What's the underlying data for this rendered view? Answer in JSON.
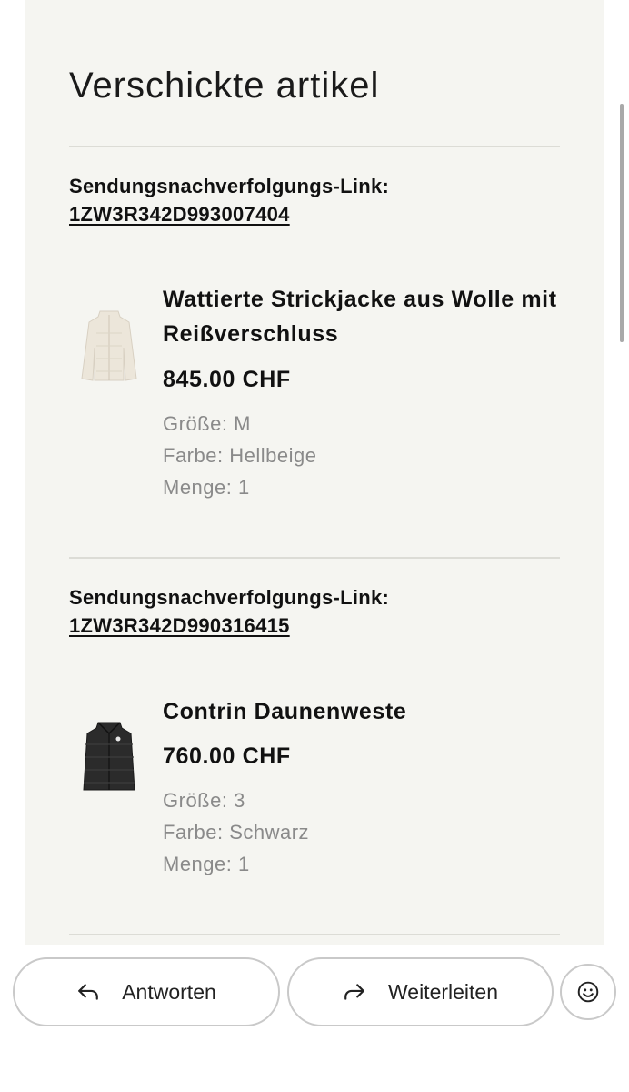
{
  "email": {
    "section_title": "Verschickte artikel",
    "shipments": [
      {
        "tracking_label": "Sendungsnachverfolgungs-Link:",
        "tracking_number": "1ZW3R342D993007404",
        "product": {
          "name": "Wattierte Strickjacke aus Wolle mit Reißverschluss",
          "price": "845.00 CHF",
          "size": "Größe: M",
          "color": "Farbe: Hellbeige",
          "quantity": "Menge: 1",
          "thumb_icon": "beige-cardigan-image"
        }
      },
      {
        "tracking_label": "Sendungsnachverfolgungs-Link:",
        "tracking_number": "1ZW3R342D990316415",
        "product": {
          "name": "Contrin Daunenweste",
          "price": "760.00 CHF",
          "size": "Größe: 3",
          "color": "Farbe: Schwarz",
          "quantity": "Menge: 1",
          "thumb_icon": "black-down-vest-image"
        }
      }
    ]
  },
  "actions": {
    "reply_label": "Antworten",
    "forward_label": "Weiterleiten",
    "reply_icon": "reply-arrow-icon",
    "forward_icon": "forward-arrow-icon",
    "emoji_icon": "smiley-icon"
  },
  "colors": {
    "panel_background": "#f5f5f1",
    "divider": "#dcdcd6",
    "muted_text": "#8a8a8a",
    "button_border": "#c9c9c9"
  }
}
